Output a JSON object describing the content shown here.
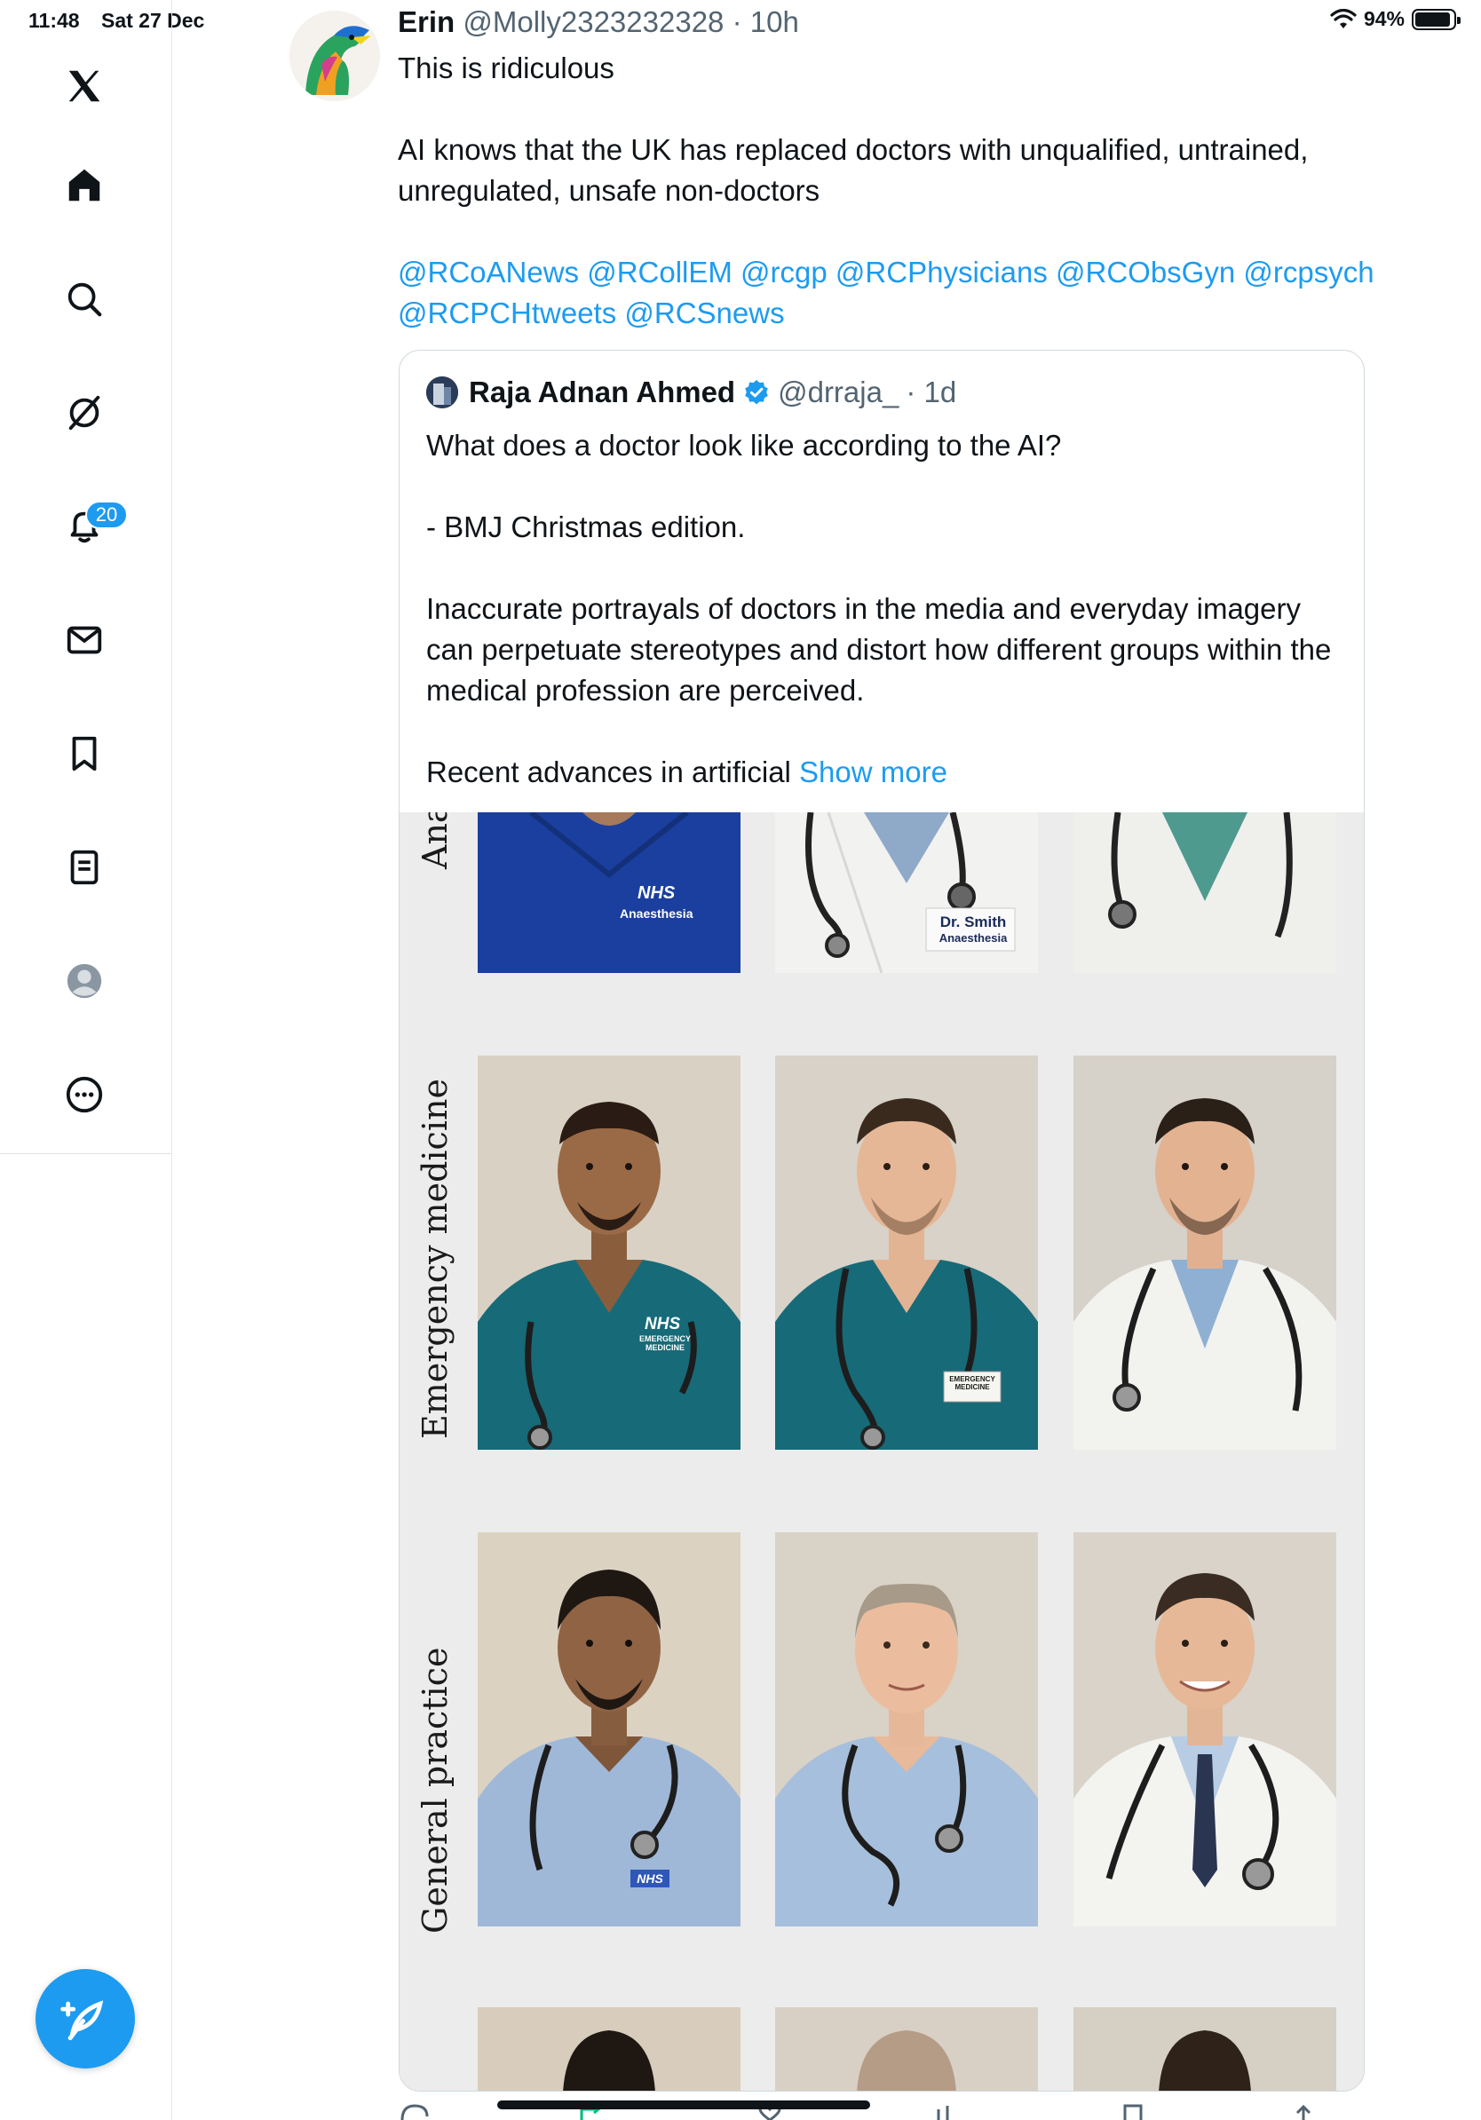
{
  "status_bar": {
    "time": "11:48",
    "date": "Sat 27 Dec",
    "battery": "94%",
    "battery_level": 0.94
  },
  "sidebar": {
    "items": [
      {
        "name": "x-logo"
      },
      {
        "name": "home"
      },
      {
        "name": "search"
      },
      {
        "name": "grok"
      },
      {
        "name": "notifications",
        "badge": "20"
      },
      {
        "name": "messages"
      },
      {
        "name": "bookmarks"
      },
      {
        "name": "lists"
      },
      {
        "name": "profile"
      },
      {
        "name": "more"
      }
    ]
  },
  "tweet": {
    "author_name": "Erin",
    "author_handle": "@Molly2323232328",
    "time": "· 10h",
    "line1": "This is ridiculous",
    "line2": "AI knows that the UK has  replaced doctors with unqualified, untrained, unregulated, unsafe non-doctors",
    "mentions": "@RCoANews @RCollEM @rcgp @RCPhysicians @RCObsGyn @rcpsych @RCPCHtweets @RCSnews"
  },
  "quote": {
    "author_name": "Raja Adnan Ahmed",
    "author_handle": "@drraja_",
    "time": "· 1d",
    "p1": "What does a doctor look like according to the AI?",
    "p2": "- BMJ Christmas edition.",
    "p3": "Inaccurate portrayals of doctors in the media and everyday imagery can perpetuate stereotypes and distort how different groups within the medical profession are perceived.",
    "p4": "Recent advances in artificial",
    "show_more": "Show more"
  },
  "image": {
    "rows": [
      {
        "label": "Ana"
      },
      {
        "label": "Emergency medicine"
      },
      {
        "label": "General practice"
      }
    ],
    "badges": {
      "nhs": "NHS",
      "anaesthesia": "Anaesthesia",
      "dr_smith": "Dr. Smith",
      "dr_smith_dept": "Anaesthesia",
      "em_badge": "EMERGENCY MEDICINE"
    }
  },
  "colors": {
    "accent": "#1d9bf0",
    "scrub_blue": "#1b3f9e",
    "scrub_teal": "#176a78",
    "shirt_blue": "#9fb8d8"
  }
}
